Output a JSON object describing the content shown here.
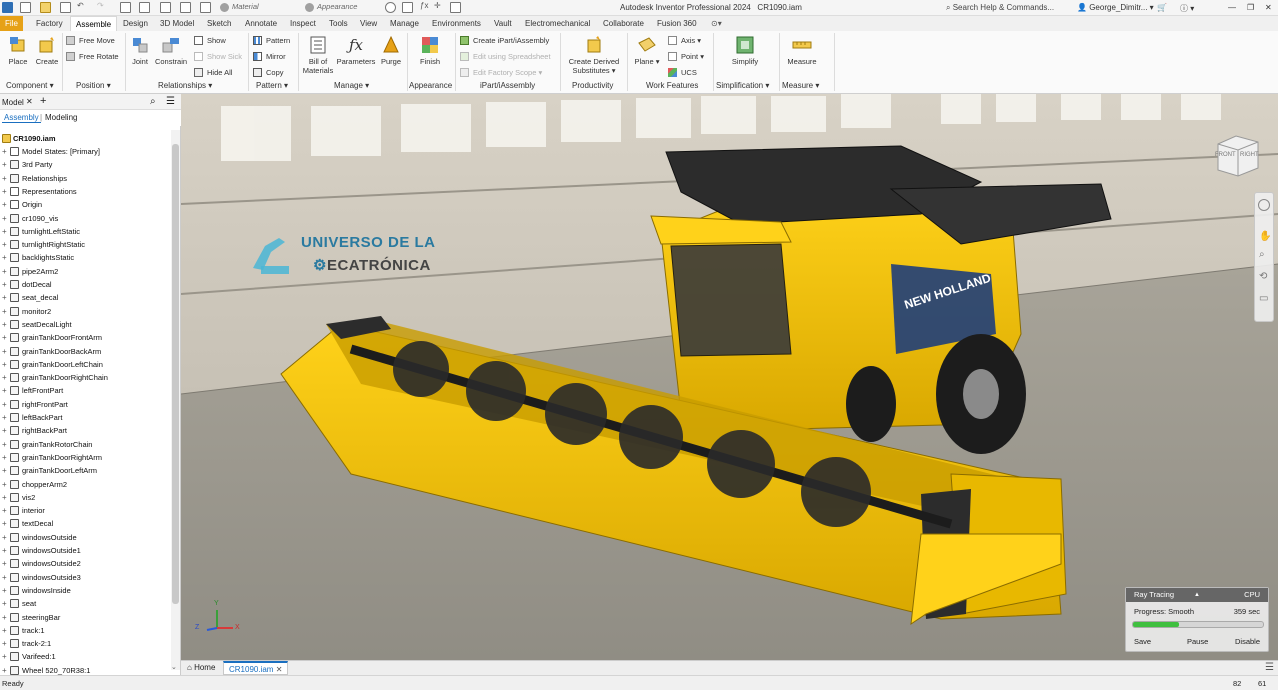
{
  "app": {
    "title": "Autodesk Inventor Professional 2024",
    "document": "CR1090.iam",
    "search_placeholder": "Search Help & Commands...",
    "user": "George_Dimitr...",
    "material_placeholder": "Material",
    "appearance_placeholder": "Appearance"
  },
  "tabs": [
    "File",
    "Factory",
    "Assemble",
    "Design",
    "3D Model",
    "Sketch",
    "Annotate",
    "Inspect",
    "Tools",
    "View",
    "Manage",
    "Environments",
    "Vault",
    "Electromechanical",
    "Collaborate",
    "Fusion 360"
  ],
  "active_tab": "Assemble",
  "ribbon": {
    "component": {
      "group": "Component",
      "place": "Place",
      "create": "Create"
    },
    "position": {
      "group": "Position",
      "free_move": "Free Move",
      "free_rotate": "Free Rotate"
    },
    "relationships": {
      "group": "Relationships",
      "joint": "Joint",
      "constrain": "Constrain",
      "show": "Show",
      "show_sick": "Show Sick",
      "hide_all": "Hide All"
    },
    "pattern": {
      "group": "Pattern",
      "pattern": "Pattern",
      "mirror": "Mirror",
      "copy": "Copy"
    },
    "manage": {
      "group": "Manage",
      "bom_line1": "Bill of",
      "bom_line2": "Materials",
      "parameters": "Parameters",
      "purge": "Purge"
    },
    "appearance": {
      "group": "Appearance",
      "finish": "Finish"
    },
    "ipart": {
      "group": "iPart/iAssembly",
      "create": "Create iPart/iAssembly",
      "edit_spreadsheet": "Edit using Spreadsheet",
      "edit_factory": "Edit Factory Scope"
    },
    "productivity": {
      "group": "Productivity",
      "cds_line1": "Create Derived",
      "cds_line2": "Substitutes"
    },
    "work_features": {
      "group": "Work Features",
      "plane": "Plane",
      "axis": "Axis",
      "point": "Point",
      "ucs": "UCS"
    },
    "simplification": {
      "group": "Simplification",
      "simplify": "Simplify"
    },
    "measure": {
      "group": "Measure",
      "measure": "Measure"
    }
  },
  "panel": {
    "title": "Model",
    "subtab_assembly": "Assembly",
    "subtab_modeling": "Modeling",
    "root": "CR1090.iam",
    "items": [
      "Model States: [Primary]",
      "3rd Party",
      "Relationships",
      "Representations",
      "Origin",
      "cr1090_vis",
      "turnlightLeftStatic",
      "turnlightRightStatic",
      "backlightsStatic",
      "pipe2Arm2",
      "dotDecal",
      "seat_decal",
      "monitor2",
      "seatDecalLight",
      "grainTankDoorFrontArm",
      "grainTankDoorBackArm",
      "grainTankDoorLeftChain",
      "grainTankDoorRightChain",
      "leftFrontPart",
      "rightFrontPart",
      "leftBackPart",
      "rightBackPart",
      "grainTankRotorChain",
      "grainTankDoorRightArm",
      "grainTankDoorLeftArm",
      "chopperArm2",
      "vis2",
      "interior",
      "textDecal",
      "windowsOutside",
      "windowsOutside1",
      "windowsOutside2",
      "windowsOutside3",
      "windowsInside",
      "seat",
      "steeringBar",
      "track:1",
      "track-2:1",
      "Varifeed:1",
      "Wheel 520_70R38:1"
    ]
  },
  "viewport": {
    "watermark_line1": "UNIVERSO DE LA",
    "watermark_line2": "ECATRÓNICA",
    "brand": "NEW HOLLAND",
    "viewcube_front": "FRONT",
    "viewcube_right": "RIGHT",
    "triad_x": "X",
    "triad_y": "Y",
    "triad_z": "Z"
  },
  "raytracing": {
    "title": "Ray Tracing",
    "mode": "CPU",
    "progress_label": "Progress: Smooth",
    "time": "359 sec",
    "progress_fraction": 0.35,
    "save": "Save",
    "pause": "Pause",
    "disable": "Disable"
  },
  "doc_tabs": {
    "home": "Home",
    "doc": "CR1090.iam"
  },
  "status": {
    "text": "Ready",
    "num1": "82",
    "num2": "61"
  }
}
